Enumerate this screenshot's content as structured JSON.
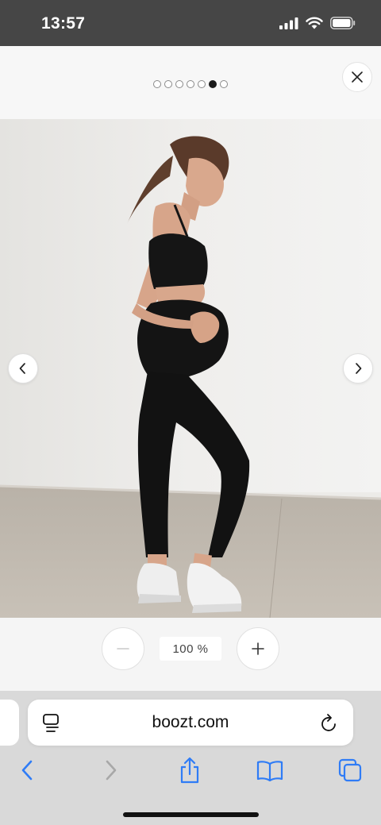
{
  "status_bar": {
    "time": "13:57",
    "icons": [
      "cellular-signal-icon",
      "wifi-icon",
      "battery-icon"
    ]
  },
  "gallery": {
    "image_count": 7,
    "active_index": 5,
    "close_icon": "close-icon",
    "prev_icon": "chevron-left-icon",
    "next_icon": "chevron-right-icon",
    "image_description_icon": "product-photo"
  },
  "zoom": {
    "level": "100 %",
    "zoom_out_icon": "minus-icon",
    "zoom_in_icon": "plus-icon"
  },
  "browser": {
    "url": "boozt.com",
    "reader_icon": "page-menu-icon",
    "reload_icon": "reload-icon",
    "toolbar": [
      "back-icon",
      "forward-icon",
      "share-icon",
      "bookmarks-icon",
      "tabs-icon"
    ],
    "accent": "#2f7cf6",
    "disabled": "#a8a8a8"
  }
}
